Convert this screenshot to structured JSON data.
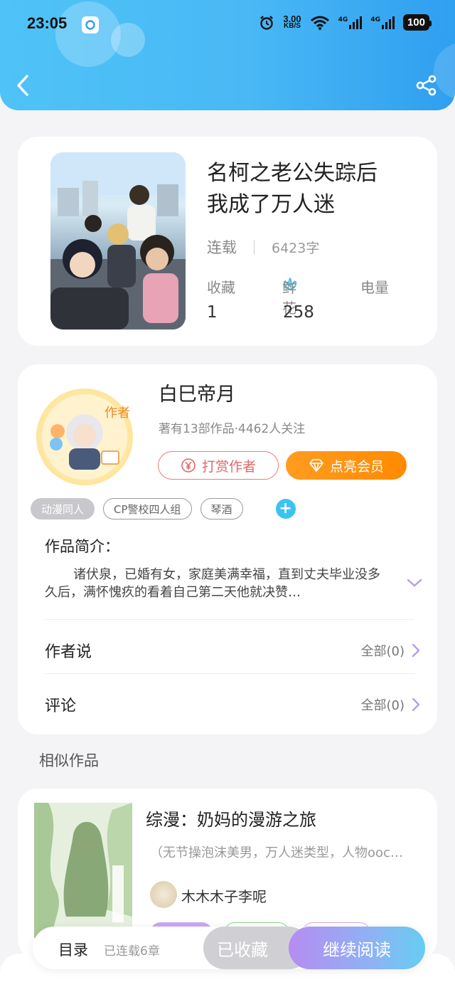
{
  "status_bar": {
    "time": "23:05",
    "net_speed_value": "3.00",
    "net_speed_unit": "KB/S",
    "signal_1": "4G",
    "signal_2": "4G",
    "battery": "100"
  },
  "header": {
    "back_icon": "chevron-left-icon",
    "share_icon": "share-icon"
  },
  "book": {
    "title_line1": "名柯之老公失踪后",
    "title_line2": "我成了万人迷",
    "status": "连载",
    "word_count": "6423字",
    "stats": {
      "favorites_label": "收藏",
      "favorites_value": "1",
      "flowers_label": "鲜花",
      "flowers_value": "258",
      "power_label": "电量",
      "power_value": ""
    }
  },
  "author": {
    "name": "白巳帝月",
    "summary": "著有13部作品·4462人关注",
    "avatar_badge": "作者",
    "tip_button": "打赏作者",
    "vip_button": "点亮会员"
  },
  "tags": [
    "动漫同人",
    "CP警校四人组",
    "琴酒"
  ],
  "tag_add": "+",
  "intro": {
    "label": "作品简介：",
    "text": "诸伏泉，已婚有女，家庭美满幸福，直到丈夫毕业没多久后，满怀愧疚的看着自己第二天他就决赞…"
  },
  "author_says": {
    "label": "作者说",
    "value": "全部(0)"
  },
  "comments": {
    "label": "评论",
    "value": "全部(0)"
  },
  "similar": {
    "heading": "相似作品",
    "items": [
      {
        "title": "综漫：奶妈的漫游之旅",
        "desc": "（无节操泡沫美男，万人迷类型，人物ooc…",
        "author": "木木木子李呢"
      }
    ]
  },
  "bottom_bar": {
    "toc_label": "目录",
    "toc_sub": "已连载6章",
    "collected_label": "已收藏",
    "read_label": "继续阅读"
  },
  "colors": {
    "header_start": "#4fc3f7",
    "header_end": "#2f9ff0",
    "tip_red": "#e06868",
    "vip_orange": "#ff8a00",
    "read_gradient_start": "#b68cf2",
    "read_gradient_end": "#66cdf2",
    "accent_blue": "#3cc2f3"
  }
}
